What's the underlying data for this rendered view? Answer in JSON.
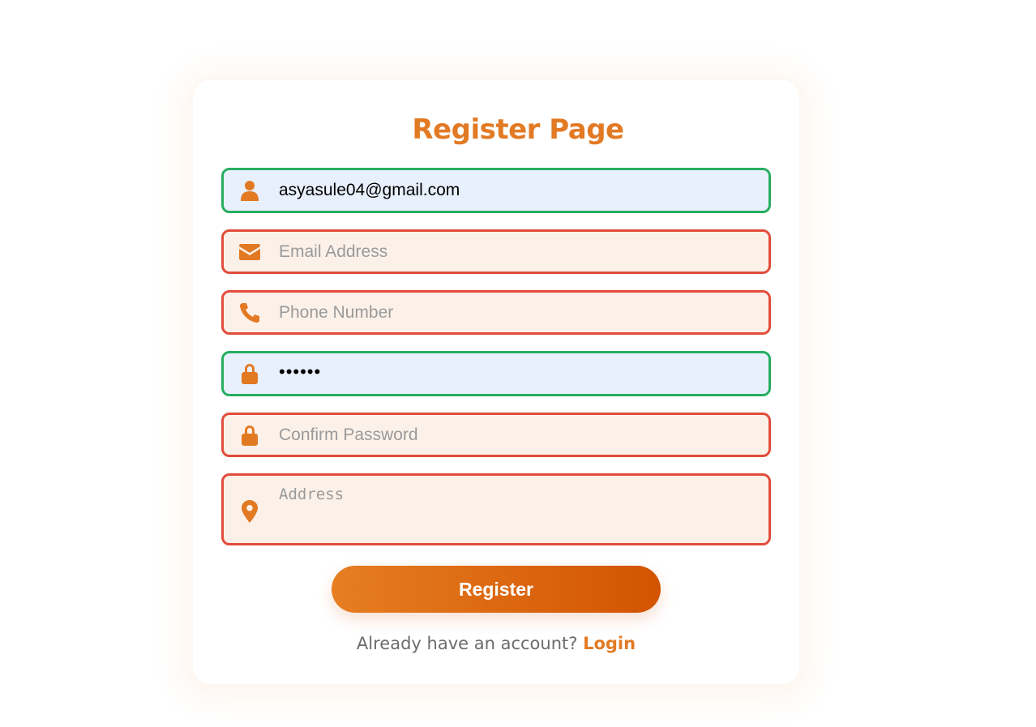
{
  "page": {
    "title": "Register Page"
  },
  "form": {
    "username": {
      "value": "asyasule04@gmail.com",
      "icon": "user-icon",
      "state": "valid"
    },
    "email": {
      "placeholder": "Email Address",
      "icon": "envelope-icon",
      "state": "invalid"
    },
    "phone": {
      "placeholder": "Phone Number",
      "icon": "phone-icon",
      "state": "invalid"
    },
    "password": {
      "value": "••••••",
      "icon": "lock-icon",
      "state": "valid"
    },
    "confirm_password": {
      "placeholder": "Confirm Password",
      "icon": "lock-icon",
      "state": "invalid"
    },
    "address": {
      "placeholder": "Address",
      "icon": "map-marker-icon",
      "state": "invalid"
    }
  },
  "actions": {
    "register_label": "Register"
  },
  "footer": {
    "prompt": "Already have an account?",
    "login_label": "Login"
  },
  "colors": {
    "accent": "#e27a24",
    "valid_border": "#27ae60",
    "invalid_border": "#e24c3b",
    "valid_bg": "#e8f0fd",
    "invalid_bg": "#fcf1e9",
    "button_gradient_start": "#e67e22",
    "button_gradient_end": "#d35400"
  }
}
